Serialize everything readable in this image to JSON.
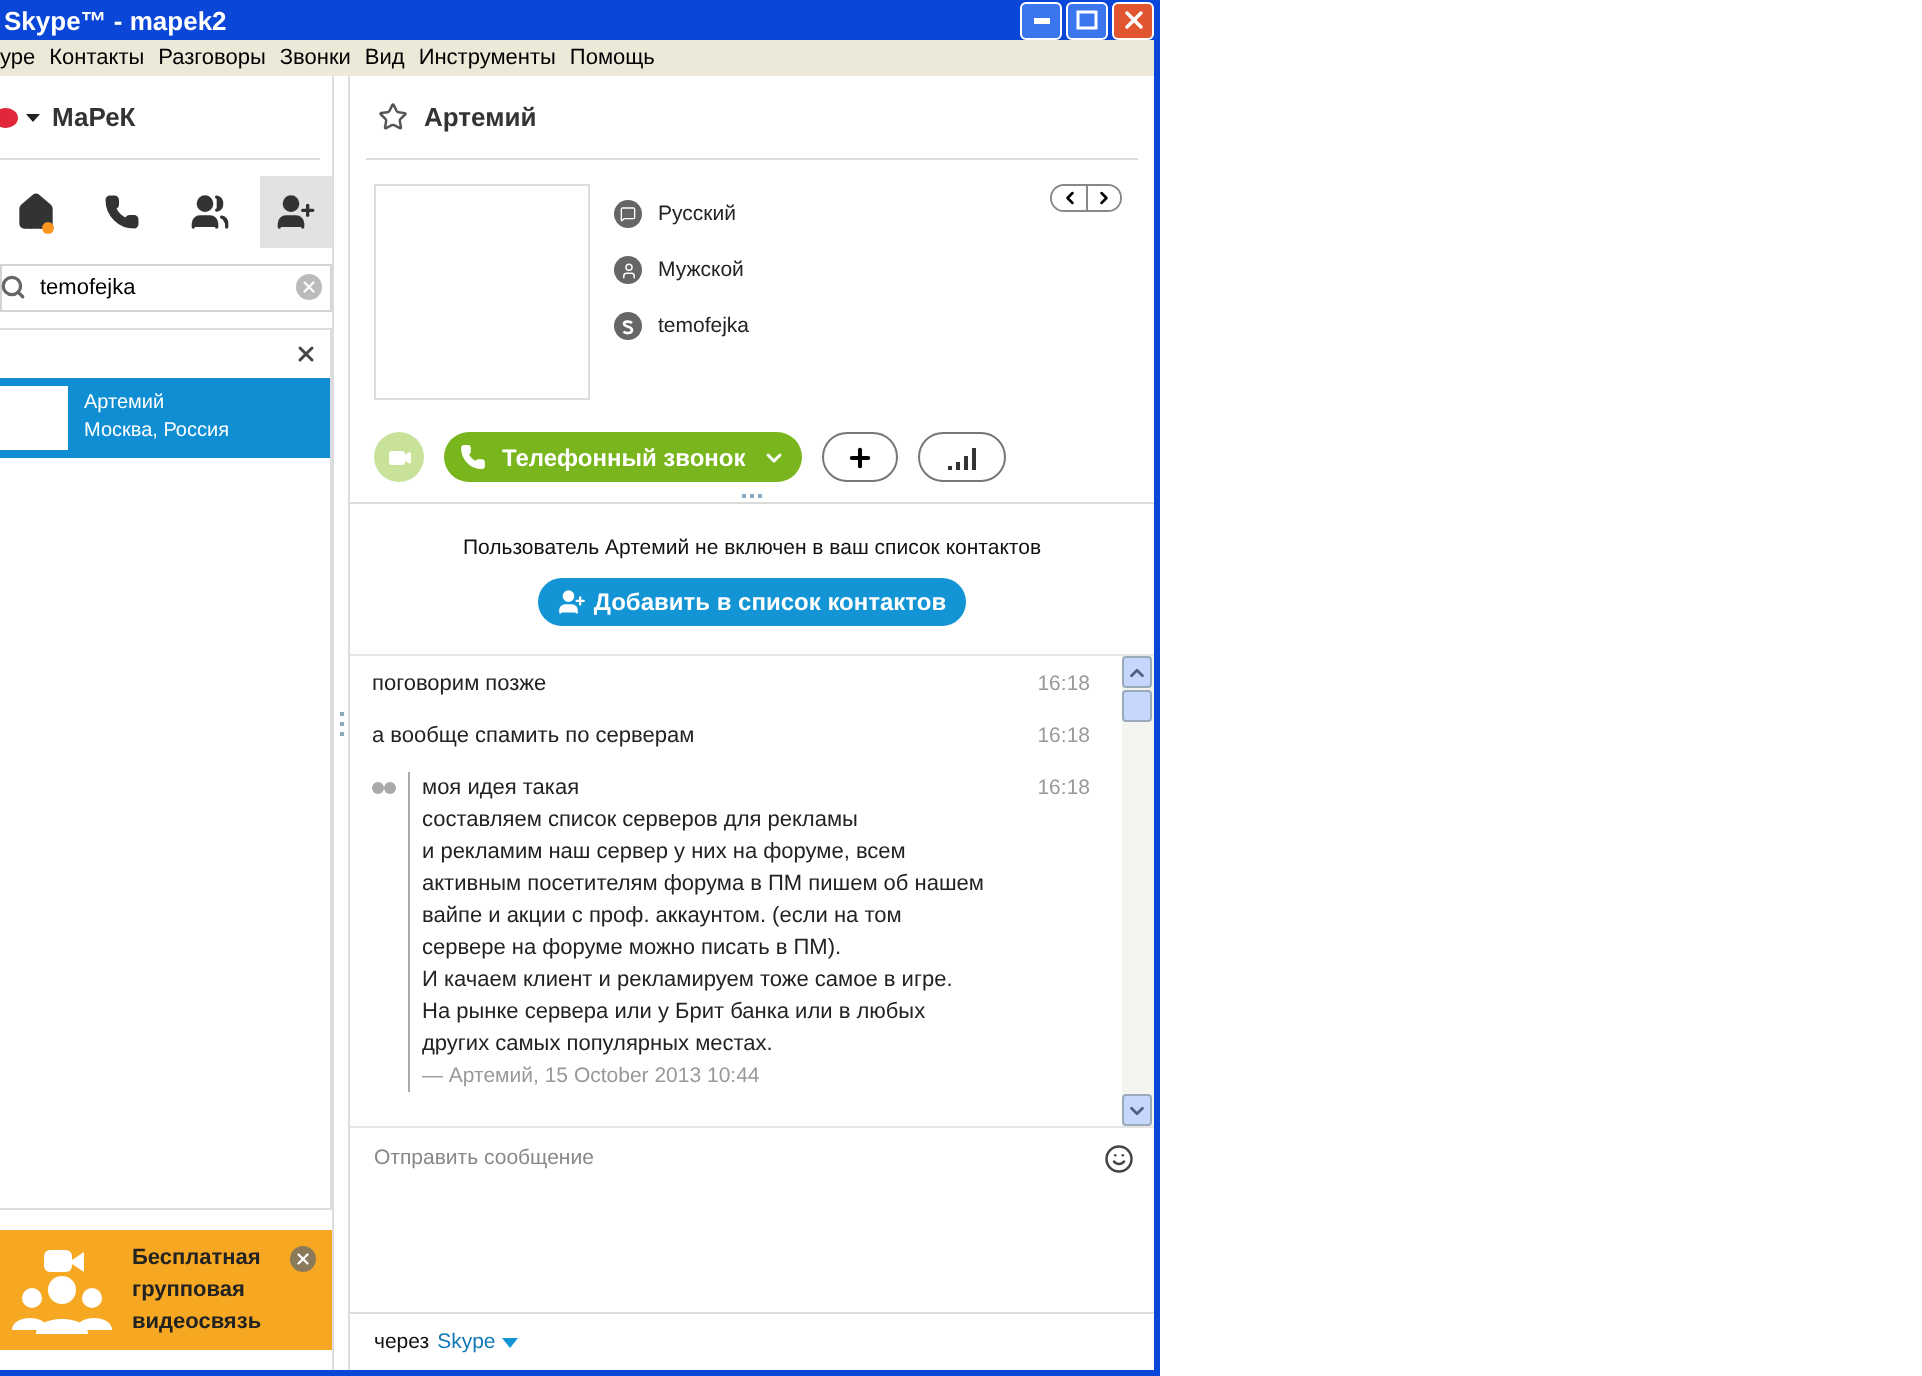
{
  "window": {
    "title": "Skype™ - mapek2"
  },
  "menu": [
    "уре",
    "Контакты",
    "Разговоры",
    "Звонки",
    "Вид",
    "Инструменты",
    "Помощь"
  ],
  "sidebar": {
    "user": "МаРеК",
    "nav": [
      {
        "kind": "home",
        "selected": false,
        "badge": true
      },
      {
        "kind": "phone",
        "selected": false,
        "badge": false
      },
      {
        "kind": "group",
        "selected": false,
        "badge": false
      },
      {
        "kind": "add",
        "selected": true,
        "badge": false
      }
    ],
    "search": {
      "value": "temofejka"
    },
    "results": [
      {
        "name": "Артемий",
        "location": "Москва, Россия",
        "selected": true
      }
    ],
    "promo": {
      "text": "Бесплатная групповая видеосвязь"
    }
  },
  "contact": {
    "name": "Артемий",
    "info": [
      {
        "kind": "language",
        "text": "Русский"
      },
      {
        "kind": "gender",
        "text": "Мужской"
      },
      {
        "kind": "skype",
        "text": "temofejka"
      }
    ],
    "call_button": "Телефонный звонок",
    "notice": "Пользователь Артемий не включен в ваш список контактов",
    "add_button": "Добавить в список контактов"
  },
  "messages": [
    {
      "kind": "plain",
      "text": "поговорим позже",
      "time": "16:18"
    },
    {
      "kind": "plain",
      "text": "а вообще спамить по серверам",
      "time": "16:18"
    },
    {
      "kind": "quote",
      "text": "моя идея такая\nсоставляем список серверов для рекламы\nи рекламим наш сервер у них на форуме, всем\nактивным посетителям форума в ПМ пишем об нашем\nвайпе и акции с проф. аккаунтом. (если на том\nсервере на форуме можно писать в ПМ).\nИ качаем клиент и рекламируем тоже самое в игре.\nНа рынке сервера или у Брит банка или в любых\nдругих самых популярных местах.",
      "source": "— Артемий, 15 October 2013 10:44",
      "time": "16:18"
    }
  ],
  "composer": {
    "placeholder": "Отправить сообщение",
    "via": "через",
    "service": "Skype"
  }
}
